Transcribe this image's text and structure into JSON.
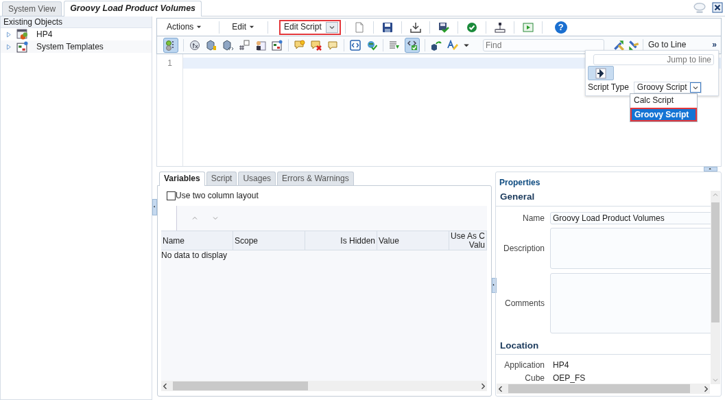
{
  "tabs": [
    {
      "label": "System View",
      "selected": false
    },
    {
      "label": "Groovy Load Product Volumes",
      "selected": true
    }
  ],
  "sidebar": {
    "title": "Existing Objects",
    "items": [
      {
        "label": "HP4",
        "expanded": false,
        "kind": "application"
      },
      {
        "label": "System Templates",
        "expanded": false,
        "kind": "templates"
      }
    ]
  },
  "toolbar": {
    "menus": [
      "Actions",
      "Edit"
    ],
    "mode_select": "Edit Script",
    "help": "?",
    "find_placeholder": "Find",
    "goto_label": "Go to Line",
    "overflow": "»",
    "toggles": [
      {
        "on": true
      },
      {
        "on": true
      }
    ]
  },
  "editor": {
    "line_numbers": [
      "1"
    ]
  },
  "goto_popup": {
    "placeholder": "Jump to line",
    "script_type_label": "Script Type",
    "script_type_value": "Groovy Script",
    "options": [
      {
        "label": "Calc Script",
        "selected": false
      },
      {
        "label": "Groovy Script",
        "selected": true
      }
    ]
  },
  "bottom_tabs": [
    {
      "label": "Variables",
      "selected": true
    },
    {
      "label": "Script",
      "selected": false
    },
    {
      "label": "Usages",
      "selected": false
    },
    {
      "label": "Errors & Warnings",
      "selected": false
    }
  ],
  "two_column": {
    "label": "Use two column layout",
    "checked": false
  },
  "table": {
    "columns": [
      "Name",
      "Scope",
      "Is Hidden",
      "Value",
      "Use As C\nValu"
    ],
    "empty_text": "No data to display"
  },
  "properties": {
    "title": "Properties",
    "sections": [
      {
        "title": "General",
        "fields": [
          {
            "label": "Name",
            "kind": "text",
            "value": "Groovy Load Product Volumes"
          },
          {
            "label": "Description",
            "kind": "textarea"
          },
          {
            "label": "Comments",
            "kind": "textarea"
          }
        ]
      },
      {
        "title": "Location",
        "fields": [
          {
            "label": "Application",
            "kind": "static",
            "value": "HP4"
          },
          {
            "label": "Cube",
            "kind": "static",
            "value": "OEP_FS"
          }
        ]
      }
    ]
  }
}
